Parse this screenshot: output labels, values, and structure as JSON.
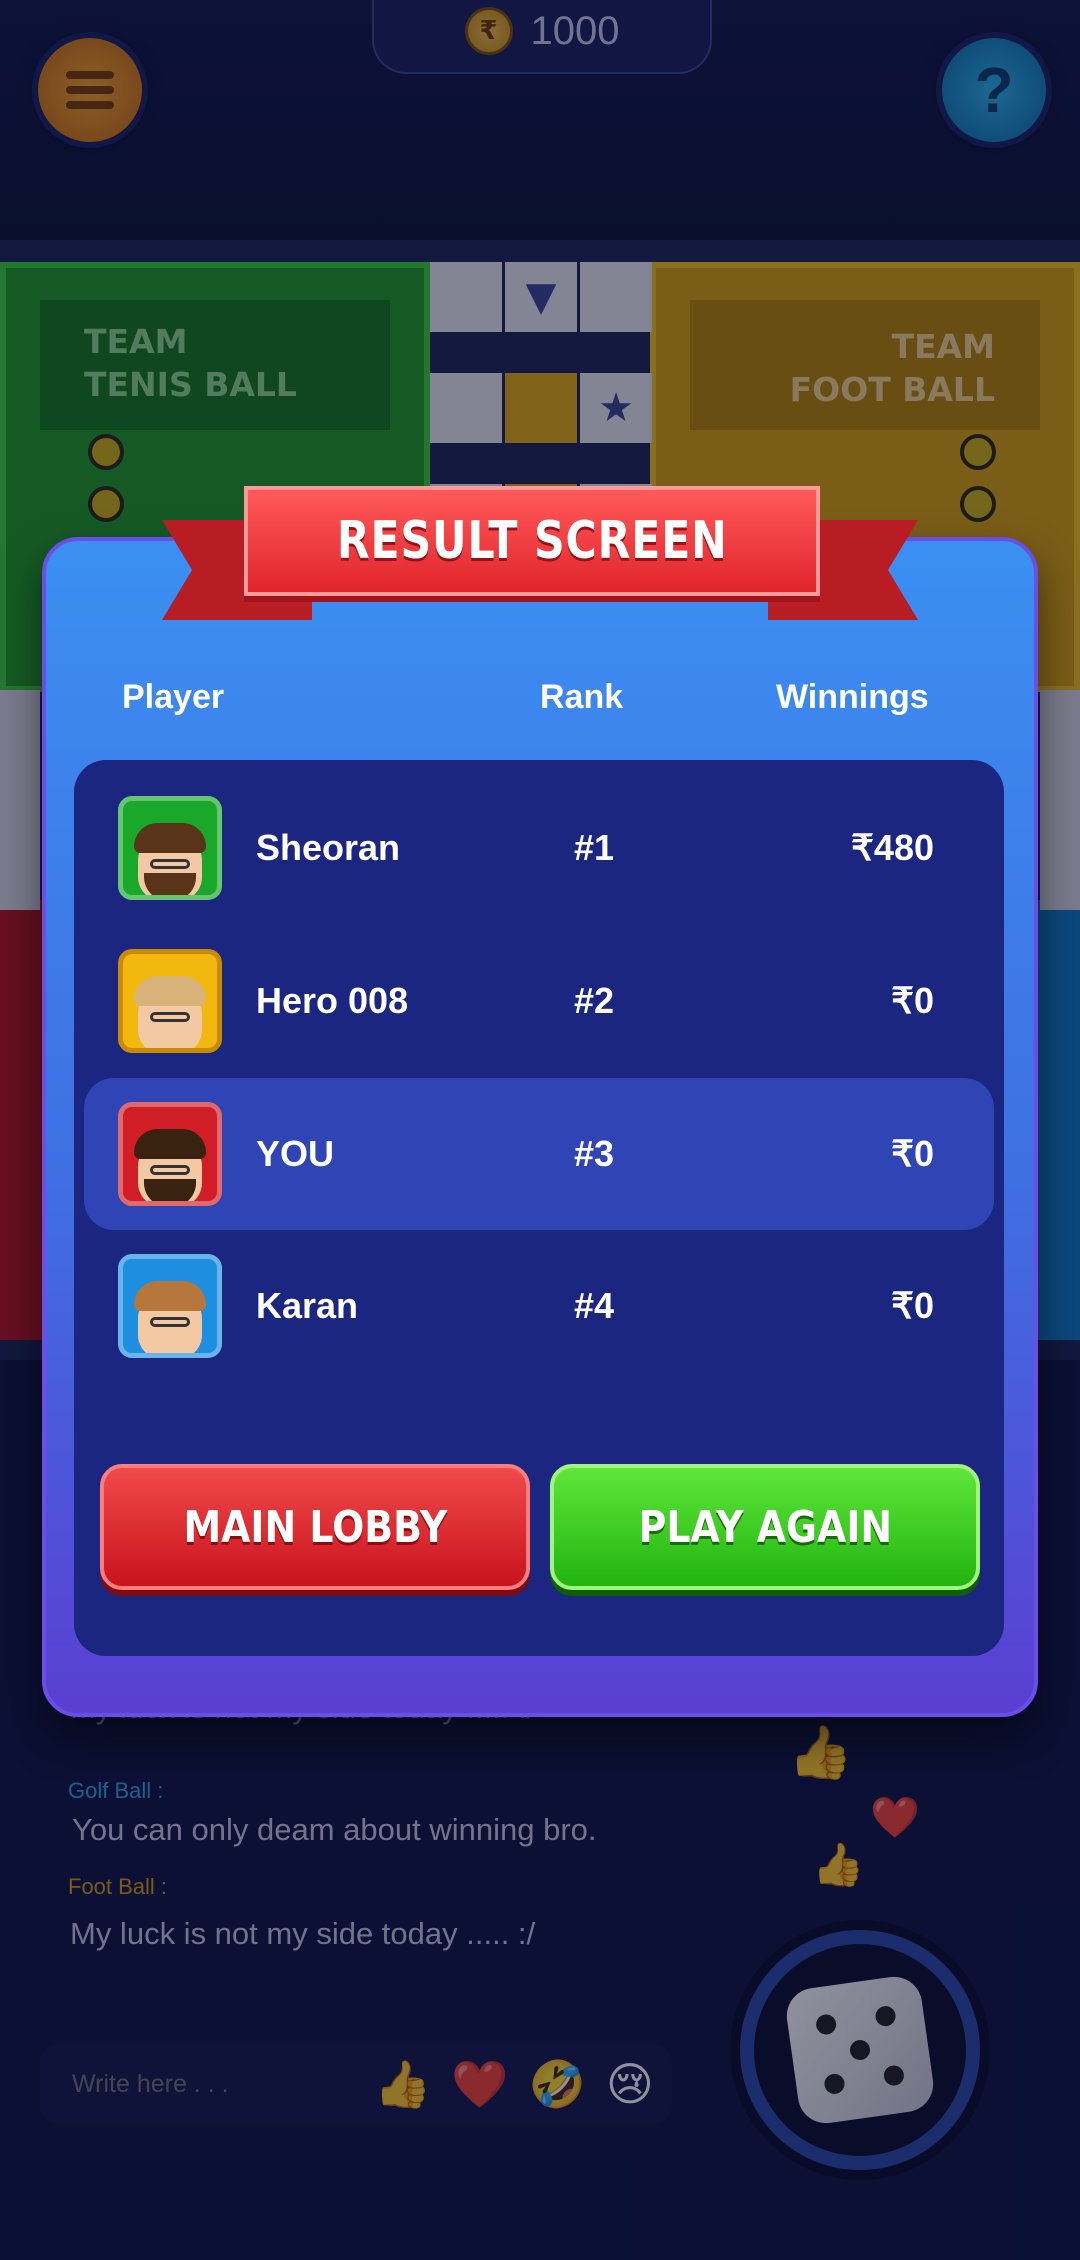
{
  "header": {
    "coin_icon": "rupee-coin-icon",
    "coin_balance": "1000",
    "menu_icon": "menu-icon",
    "help_icon": "help-icon"
  },
  "board": {
    "team_green": "TEAM\nTENIS BALL",
    "team_yellow": "TEAM\nFOOT BALL",
    "colors": {
      "green": "#1f9b25",
      "yellow": "#d7a00b",
      "red": "#b3131c",
      "blue": "#0f7bc5"
    }
  },
  "result": {
    "title": "RESULT SCREEN",
    "headers": {
      "player": "Player",
      "rank": "Rank",
      "winnings": "Winnings"
    },
    "rows": [
      {
        "name": "Sheoran",
        "rank": "#1",
        "winnings": "₹480",
        "avatar_color": "#1aa82a",
        "is_me": false
      },
      {
        "name": "Hero 008",
        "rank": "#2",
        "winnings": "₹0",
        "avatar_color": "#f2b80e",
        "is_me": false
      },
      {
        "name": "YOU",
        "rank": "#3",
        "winnings": "₹0",
        "avatar_color": "#d11e26",
        "is_me": true
      },
      {
        "name": "Karan",
        "rank": "#4",
        "winnings": "₹0",
        "avatar_color": "#1e8fe0",
        "is_me": false
      }
    ],
    "main_lobby": "MAIN LOBBY",
    "play_again": "PLAY AGAIN"
  },
  "chat": {
    "messages": [
      {
        "sender": "",
        "text": "My luck is not my side today ..... :/",
        "color": "#c9cbe0"
      },
      {
        "sender": "Golf Ball :",
        "text": "You can only deam about winning bro.",
        "color": "#2aa8e8"
      },
      {
        "sender": "Foot Ball :",
        "text": "My luck is not my side today ..... :/",
        "color": "#d89a12"
      }
    ],
    "input_placeholder": "Write here . . .",
    "quick_emojis": [
      "👍",
      "❤️",
      "🤣",
      "😢"
    ],
    "floating_emojis": [
      "👍",
      "❤️",
      "👍"
    ]
  }
}
